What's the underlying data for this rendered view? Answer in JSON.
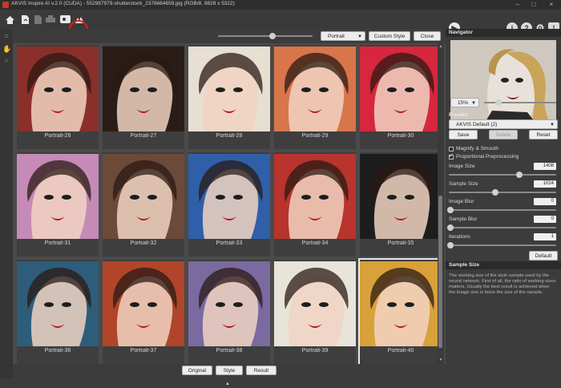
{
  "window": {
    "title": "AKVIS Inspire AI v.2.0 (CUDA) - 552987979-shutterstock_2376664659.jpg (RGB/8, 9828 x 5322)",
    "minimize": "–",
    "maximize": "□",
    "close": "×"
  },
  "toolbar": {
    "icons": [
      "home-icon",
      "open-file-icon",
      "save-icon",
      "print-icon",
      "share-icon",
      "batch-icon",
      "styles-icon"
    ],
    "right_icons": [
      "run-icon",
      "info-icon",
      "help-icon",
      "settings-icon",
      "notifications-icon"
    ],
    "right_glyphs": [
      "▶",
      "i",
      "?",
      "⚙",
      "!"
    ]
  },
  "subbar": {
    "category": "Portrait",
    "custom_style_label": "Custom Style",
    "close_label": "Close"
  },
  "gallery": {
    "tiles": [
      {
        "label": "Portrait-26",
        "bg": "#8a2f2a"
      },
      {
        "label": "Portrait-27",
        "bg": "#2a1d17"
      },
      {
        "label": "Portrait-28",
        "bg": "#e6dfd2"
      },
      {
        "label": "Portrait-29",
        "bg": "#d8754a"
      },
      {
        "label": "Portrait-30",
        "bg": "#d7263d"
      },
      {
        "label": "Portrait-31",
        "bg": "#c58ab6"
      },
      {
        "label": "Portrait-32",
        "bg": "#6b4a3a"
      },
      {
        "label": "Portrait-33",
        "bg": "#2f5fa8"
      },
      {
        "label": "Portrait-34",
        "bg": "#b8342c"
      },
      {
        "label": "Portrait-35",
        "bg": "#1d1d1d"
      },
      {
        "label": "Portrait-36",
        "bg": "#2d5d7a"
      },
      {
        "label": "Portrait-37",
        "bg": "#b0452a"
      },
      {
        "label": "Portrait-38",
        "bg": "#7b6aa0"
      },
      {
        "label": "Portrait-39",
        "bg": "#e8e4da"
      },
      {
        "label": "Portrait-40",
        "bg": "#d9a13a"
      }
    ]
  },
  "bottombar": {
    "original_label": "Original",
    "style_label": "Style",
    "result_label": "Result",
    "expand_glyph": "▲"
  },
  "navigator": {
    "header": "Navigator",
    "zoom": "15%"
  },
  "presets": {
    "header": "Presets",
    "selected": "AKVIS Default (2)",
    "save_label": "Save",
    "delete_label": "Delete",
    "reset_label": "Reset"
  },
  "settings": {
    "magnify_label": "Magnify & Smooth",
    "magnify_checked": false,
    "proportional_label": "Proportional Preprocessing",
    "proportional_checked": true,
    "image_size_label": "Image Size",
    "image_size_value": "1408",
    "sample_size_label": "Sample Size",
    "sample_size_value": "1024",
    "image_blur_label": "Image Blur",
    "image_blur_value": "0",
    "sample_blur_label": "Sample Blur",
    "sample_blur_value": "0",
    "iterations_label": "Iterations",
    "iterations_value": "1",
    "default_label": "Default"
  },
  "hint": {
    "header": "Sample Size",
    "text": "The working size of the style sample used by the neural network. First of all, the ratio of working sizes matters. Usually the best result is achieved when the image size is twice the size of the sample."
  },
  "colors": {
    "highlight_circle": "#e01b1b",
    "panel_bg": "#3c3c3c",
    "gallery_bg": "#4a4a4a"
  }
}
